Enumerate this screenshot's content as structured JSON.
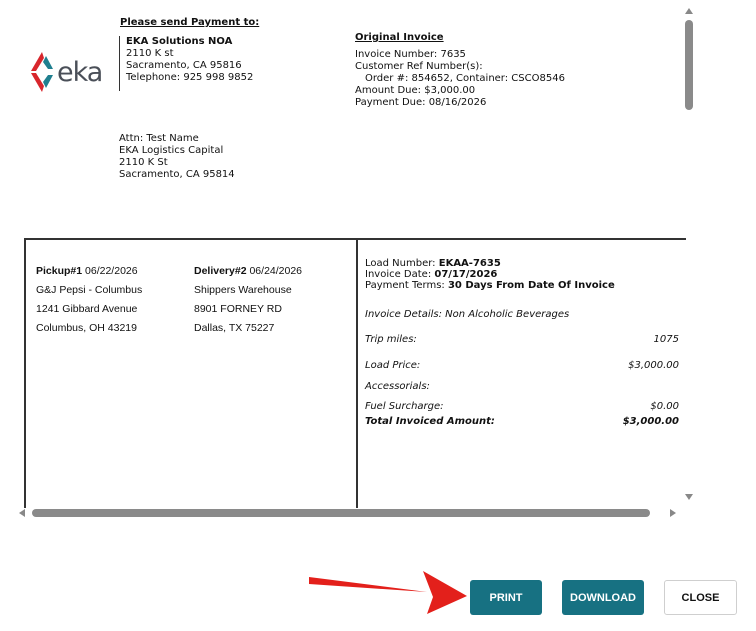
{
  "invoice": {
    "remit": {
      "heading": "Please send Payment to:",
      "name": "EKA Solutions NOA",
      "street": "2110 K st",
      "city": "Sacramento, CA 95816",
      "phone": "Telephone: 925 998 9852"
    },
    "logo": {
      "text": "eka",
      "colors": {
        "red": "#d8262c",
        "teal": "#1f7f8f"
      }
    },
    "original": {
      "title": "Original Invoice",
      "invoice_number": "Invoice Number: 7635",
      "ref_label": "Customer Ref Number(s):",
      "ref_detail": "Order #: 854652, Container: CSCO8546",
      "amount_due": "Amount Due: $3,000.00",
      "payment_due": "Payment Due: 08/16/2026"
    },
    "attn": {
      "line1": "Attn: Test Name",
      "line2": "EKA Logistics Capital",
      "line3": "2110 K St",
      "line4": "Sacramento, CA 95814"
    },
    "pickup": {
      "label": "Pickup#1",
      "date": "06/22/2026",
      "company": "G&J Pepsi - Columbus",
      "street": "1241 Gibbard Avenue",
      "city": "Columbus, OH 43219"
    },
    "delivery": {
      "label": "Delivery#2",
      "date": "06/24/2026",
      "company": "Shippers Warehouse",
      "street": "8901 FORNEY RD",
      "city": "Dallas, TX 75227"
    },
    "load": {
      "number_label": "Load Number:",
      "number": "EKAA-7635",
      "date_label": "Invoice Date:",
      "date": "07/17/2026",
      "terms_label": "Payment Terms:",
      "terms": "30 Days From Date Of Invoice",
      "details": "Invoice Details: Non Alcoholic Beverages",
      "trip_label": "Trip miles:",
      "trip_value": "1075",
      "price_label": "Load Price:",
      "price_value": "$3,000.00",
      "accessorials_label": "Accessorials:",
      "fuel_label": "Fuel Surcharge:",
      "fuel_value": "$0.00",
      "total_label": "Total Invoiced Amount:",
      "total_value": "$3,000.00"
    }
  },
  "actions": {
    "print": "PRINT",
    "download": "DOWNLOAD",
    "close": "CLOSE"
  },
  "colors": {
    "button_teal": "#177182",
    "arrow_red": "#e3201b"
  }
}
